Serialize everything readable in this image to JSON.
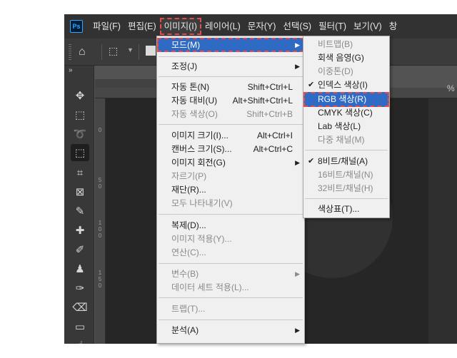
{
  "app": {
    "logo": "Ps"
  },
  "menubar": {
    "items": [
      "파일(F)",
      "편집(E)",
      "이미지(I)",
      "레이어(L)",
      "문자(Y)",
      "선택(S)",
      "필터(T)",
      "보기(V)",
      "창"
    ],
    "active": "이미지(I)"
  },
  "optionsbar": {
    "home_icon": "home-icon",
    "tool_icon": "select-icon"
  },
  "ruler": {
    "h_label": "2500",
    "v_marks": [
      "0",
      "5\n0",
      "1\n0\n0",
      "1\n5\n0"
    ]
  },
  "zoom_fragment": "%",
  "image_menu": {
    "items": [
      {
        "label": "모드(M)",
        "shortcut": "",
        "submenu": true,
        "disabled": false,
        "highlight": true
      },
      {
        "label": "조정(J)",
        "shortcut": "",
        "submenu": true,
        "disabled": false
      },
      {
        "label": "자동 톤(N)",
        "shortcut": "Shift+Ctrl+L",
        "disabled": false
      },
      {
        "label": "자동 대비(U)",
        "shortcut": "Alt+Shift+Ctrl+L",
        "disabled": false
      },
      {
        "label": "자동 색상(O)",
        "shortcut": "Shift+Ctrl+B",
        "disabled": true
      },
      {
        "label": "이미지 크기(I)...",
        "shortcut": "Alt+Ctrl+I",
        "disabled": false
      },
      {
        "label": "캔버스 크기(S)...",
        "shortcut": "Alt+Ctrl+C",
        "disabled": false
      },
      {
        "label": "이미지 회전(G)",
        "shortcut": "",
        "submenu": true,
        "disabled": false
      },
      {
        "label": "자르기(P)",
        "shortcut": "",
        "disabled": true
      },
      {
        "label": "재단(R)...",
        "shortcut": "",
        "disabled": false
      },
      {
        "label": "모두 나타내기(V)",
        "shortcut": "",
        "disabled": true
      },
      {
        "label": "복제(D)...",
        "shortcut": "",
        "disabled": false
      },
      {
        "label": "이미지 적용(Y)...",
        "shortcut": "",
        "disabled": true
      },
      {
        "label": "연산(C)...",
        "shortcut": "",
        "disabled": true
      },
      {
        "label": "변수(B)",
        "shortcut": "",
        "submenu": true,
        "disabled": true
      },
      {
        "label": "데이터 세트 적용(L)...",
        "shortcut": "",
        "disabled": true
      },
      {
        "label": "트랩(T)...",
        "shortcut": "",
        "disabled": true
      },
      {
        "label": "분석(A)",
        "shortcut": "",
        "submenu": true,
        "disabled": false
      }
    ]
  },
  "mode_submenu": {
    "items": [
      {
        "label": "비트맵(B)",
        "disabled": true,
        "checked": false
      },
      {
        "label": "회색 음영(G)",
        "disabled": false,
        "checked": false
      },
      {
        "label": "이중톤(D)",
        "disabled": true,
        "checked": false
      },
      {
        "label": "인덱스 색상(I)",
        "disabled": false,
        "checked": true
      },
      {
        "label": "RGB 색상(R)",
        "disabled": false,
        "checked": false,
        "highlight": true
      },
      {
        "label": "CMYK 색상(C)",
        "disabled": false,
        "checked": false
      },
      {
        "label": "Lab 색상(L)",
        "disabled": false,
        "checked": false
      },
      {
        "label": "다중 채널(M)",
        "disabled": true,
        "checked": false
      },
      {
        "label": "8비트/채널(A)",
        "disabled": false,
        "checked": true
      },
      {
        "label": "16비트/채널(N)",
        "disabled": true,
        "checked": false
      },
      {
        "label": "32비트/채널(H)",
        "disabled": true,
        "checked": false
      },
      {
        "label": "색상표(T)...",
        "disabled": false,
        "checked": false
      }
    ]
  },
  "colors": {
    "highlight": "#2f6bc4",
    "dashed_box": "#e84b4b",
    "menu_bg": "#f0f0f0",
    "app_bg": "#323232"
  }
}
